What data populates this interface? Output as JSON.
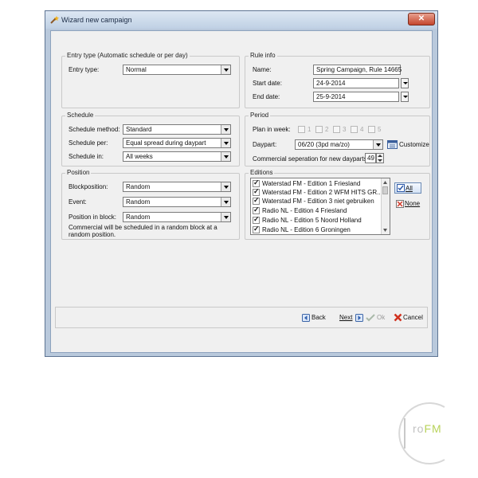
{
  "window": {
    "title": "Wizard new campaign",
    "close_symbol": "✕"
  },
  "entry_type": {
    "group_title": "Entry type (Automatic schedule or per day)",
    "label": "Entry type:",
    "value": "Normal"
  },
  "rule_info": {
    "group_title": "Rule info",
    "name_label": "Name:",
    "name_value": "Spring Campaign, Rule 14665",
    "start_label": "Start date:",
    "start_value": "24-9-2014",
    "end_label": "End date:",
    "end_value": "25-9-2014"
  },
  "schedule": {
    "group_title": "Schedule",
    "method_label": "Schedule method:",
    "method_value": "Standard",
    "per_label": "Schedule per:",
    "per_value": "Equal spread during daypart",
    "in_label": "Schedule in:",
    "in_value": "All weeks"
  },
  "period": {
    "group_title": "Period",
    "plan_label": "Plan in week:",
    "weeks": [
      "1",
      "2",
      "3",
      "4",
      "5"
    ],
    "daypart_label": "Daypart:",
    "daypart_value": "06/20 (3pd ma/zo)",
    "customize_label": "Customize",
    "separation_label": "Commercial seperation for new dayparts:",
    "separation_value": "49"
  },
  "position": {
    "group_title": "Position",
    "block_label": "Blockposition:",
    "block_value": "Random",
    "event_label": "Event:",
    "event_value": "Random",
    "inblock_label": "Position in block:",
    "inblock_value": "Random",
    "note": "Commercial will be scheduled in a random block at a random position."
  },
  "editions": {
    "group_title": "Editions",
    "items": [
      "Waterstad FM - Edition 1 Friesland",
      "Waterstad FM - Edition 2 WFM HITS GR...",
      "Waterstad FM - Edition 3 niet gebruiken",
      "Radio NL - Edition 4 Friesland",
      "Radio NL - Edition 5 Noord Holland",
      "Radio NL - Edition 6 Groningen"
    ],
    "all_label": "All",
    "none_label": "None"
  },
  "footer": {
    "back_label": "Back",
    "next_label": "Next",
    "ok_label": "Ok",
    "cancel_label": "Cancel"
  },
  "watermark": {
    "logo_text": "roFM"
  }
}
